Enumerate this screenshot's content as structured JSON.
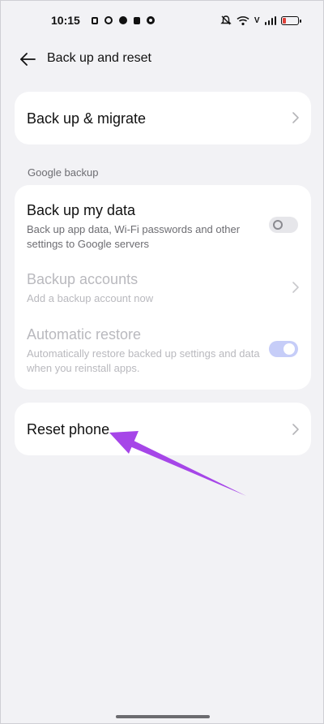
{
  "status_bar": {
    "time": "10:15",
    "left_icons": [
      "notification-icon",
      "face-icon",
      "cloud-icon",
      "vibrate-icon",
      "circle-icon"
    ],
    "right_icons": [
      "mute-icon",
      "wifi-icon",
      "vowifi-icon",
      "signal-icon",
      "battery-icon"
    ],
    "vowifi_label": "V",
    "battery_color": "#e0413a"
  },
  "header": {
    "back_icon": "arrow-left-icon",
    "title": "Back up and reset"
  },
  "cards": {
    "migrate": {
      "title": "Back up & migrate"
    },
    "google_backup": {
      "section_label": "Google backup",
      "backup_my_data": {
        "title": "Back up my data",
        "subtitle": "Back up app data, Wi-Fi passwords and other settings to Google servers",
        "toggle": "off"
      },
      "backup_accounts": {
        "title": "Backup accounts",
        "subtitle": "Add a backup account now"
      },
      "automatic_restore": {
        "title": "Automatic restore",
        "subtitle": "Automatically restore backed up settings and data when you reinstall apps.",
        "toggle": "on"
      }
    },
    "reset": {
      "title": "Reset phone"
    }
  },
  "annotation": {
    "color": "#a646e8"
  },
  "colors": {
    "background": "#f2f2f5",
    "card": "#ffffff",
    "disabled_text": "#b9b9be",
    "toggle_on": "#c6cdf8"
  }
}
